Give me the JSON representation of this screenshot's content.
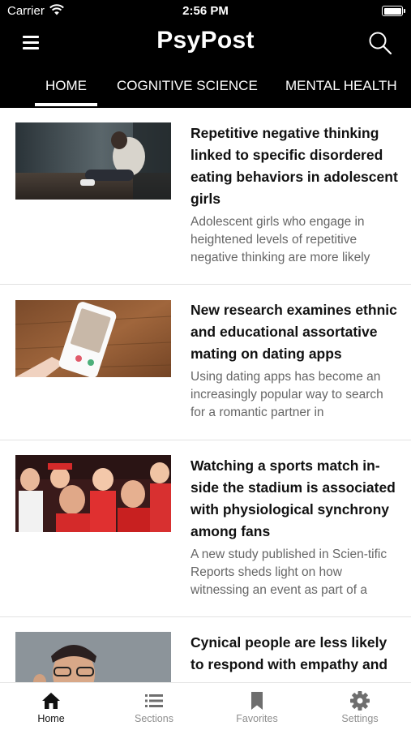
{
  "status_bar": {
    "carrier": "Carrier",
    "time": "2:56 PM"
  },
  "app": {
    "title": "PsyPost"
  },
  "tabs": [
    {
      "label": "HOME",
      "active": true
    },
    {
      "label": "COGNITIVE SCIENCE",
      "active": false
    },
    {
      "label": "MENTAL HEALTH",
      "active": false
    }
  ],
  "articles": [
    {
      "title": "Repetitive negative thinking linked to specific disordered eating behaviors in adolescent girls",
      "excerpt": "Adolescent girls who engage in heightened levels of repetitive negative thinking are more likely"
    },
    {
      "title": "New research examines ethnic and educational assortative mating on dating apps",
      "excerpt": "Using dating apps has become an increasingly popular way to search for a romantic partner in"
    },
    {
      "title": "Watching a sports match in-side the stadium is associated with physiological synchrony among fans",
      "excerpt": "A new study published in Scien-tific Reports sheds light on how witnessing an event as part of a"
    },
    {
      "title": "Cynical people are less likely to respond with empathy and",
      "excerpt": ""
    }
  ],
  "tabbar": [
    {
      "label": "Home",
      "icon": "home-icon",
      "active": true
    },
    {
      "label": "Sections",
      "icon": "list-icon",
      "active": false
    },
    {
      "label": "Favorites",
      "icon": "bookmark-icon",
      "active": false
    },
    {
      "label": "Settings",
      "icon": "gear-icon",
      "active": false
    }
  ],
  "colors": {
    "header_bg": "#000000",
    "text_primary": "#111111",
    "text_secondary": "#666666",
    "tab_inactive": "#8e8e8e"
  }
}
